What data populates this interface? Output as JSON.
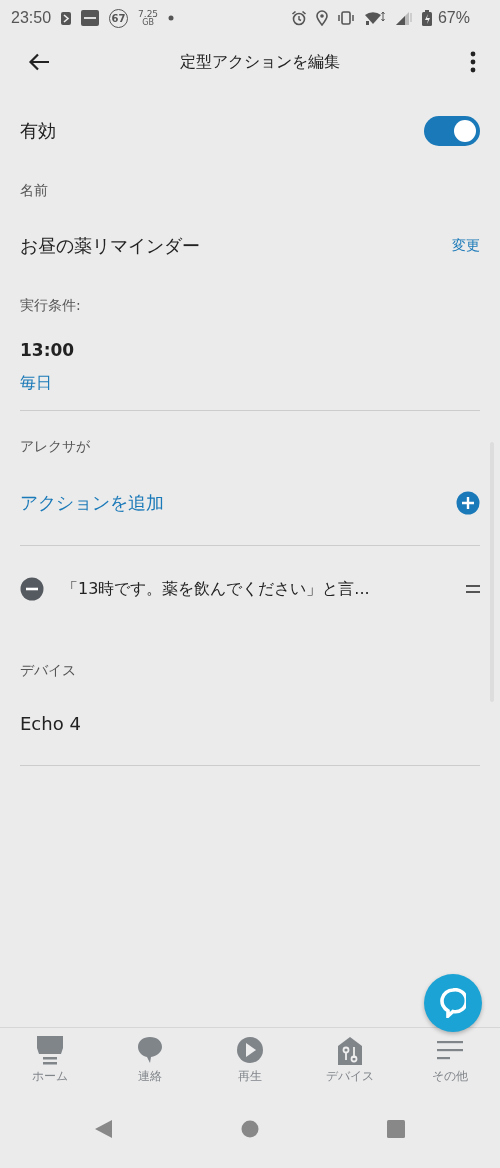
{
  "status_bar": {
    "time": "23:50",
    "badge_number": "67",
    "data_amount": "7.25",
    "data_unit": "GB",
    "battery": "67%"
  },
  "app_bar": {
    "title": "定型アクションを編集"
  },
  "enabled": {
    "label": "有効",
    "on": true
  },
  "name": {
    "label": "名前",
    "value": "お昼の薬リマインダー",
    "action": "変更"
  },
  "trigger": {
    "label": "実行条件:",
    "time": "13:00",
    "repeat": "毎日"
  },
  "actions": {
    "label": "アレクサが",
    "add_label": "アクションを追加",
    "items": [
      {
        "text": "「13時です。薬を飲んでください」と言..."
      }
    ]
  },
  "device": {
    "label": "デバイス",
    "value": "Echo 4"
  },
  "bottom_nav": [
    {
      "kind": "home",
      "label": "ホーム"
    },
    {
      "kind": "chat",
      "label": "連絡"
    },
    {
      "kind": "play",
      "label": "再生"
    },
    {
      "kind": "devices",
      "label": "デバイス"
    },
    {
      "kind": "more",
      "label": "その他"
    }
  ]
}
